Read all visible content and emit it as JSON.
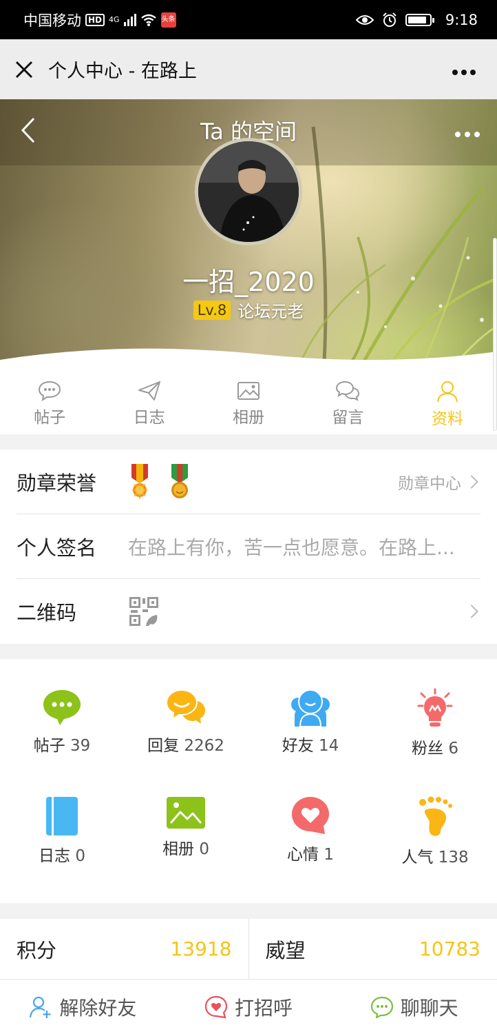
{
  "status_bar": {
    "carrier": "中国移动",
    "hd": "HD",
    "network": "4G",
    "app_badge": "头条",
    "time": "9:18"
  },
  "wechat_nav": {
    "title": "个人中心 - 在路上"
  },
  "hero": {
    "title": "Ta 的空间",
    "nickname": "一招_2020",
    "level": "Lv.8",
    "rank": "论坛元老"
  },
  "tabs": [
    {
      "label": "帖子",
      "icon": "chat-bubble-icon"
    },
    {
      "label": "日志",
      "icon": "paper-plane-icon"
    },
    {
      "label": "相册",
      "icon": "picture-icon"
    },
    {
      "label": "留言",
      "icon": "message-icon"
    },
    {
      "label": "资料",
      "icon": "person-icon",
      "active": true
    }
  ],
  "info": {
    "medals_label": "勋章荣誉",
    "medals_link": "勋章中心",
    "signature_label": "个人签名",
    "signature_value": "在路上有你，苦一点也愿意。在路上...",
    "qrcode_label": "二维码"
  },
  "stats": [
    {
      "label": "帖子",
      "value": "39",
      "icon": "chat-dots-icon",
      "color": "#8cc21a"
    },
    {
      "label": "回复",
      "value": "2262",
      "icon": "reply-bubbles-icon",
      "color": "#fbb614"
    },
    {
      "label": "好友",
      "value": "14",
      "icon": "friends-icon",
      "color": "#3eaaf1"
    },
    {
      "label": "粉丝",
      "value": "6",
      "icon": "bulb-icon",
      "color": "#f46a6a"
    },
    {
      "label": "日志",
      "value": "0",
      "icon": "notebook-icon",
      "color": "#49b8f2"
    },
    {
      "label": "相册",
      "value": "0",
      "icon": "album-icon",
      "color": "#8cc21a"
    },
    {
      "label": "心情",
      "value": "1",
      "icon": "heart-bubble-icon",
      "color": "#f46a6a"
    },
    {
      "label": "人气",
      "value": "138",
      "icon": "footprint-icon",
      "color": "#fbb614"
    }
  ],
  "scores": {
    "points_label": "积分",
    "points_value": "13918",
    "prestige_label": "威望",
    "prestige_value": "10783"
  },
  "bottom_bar": {
    "unfriend": "解除好友",
    "greet": "打招呼",
    "chat": "聊聊天"
  },
  "colors": {
    "accent": "#f5c514",
    "text": "#222222",
    "muted": "#aaaaaa"
  }
}
